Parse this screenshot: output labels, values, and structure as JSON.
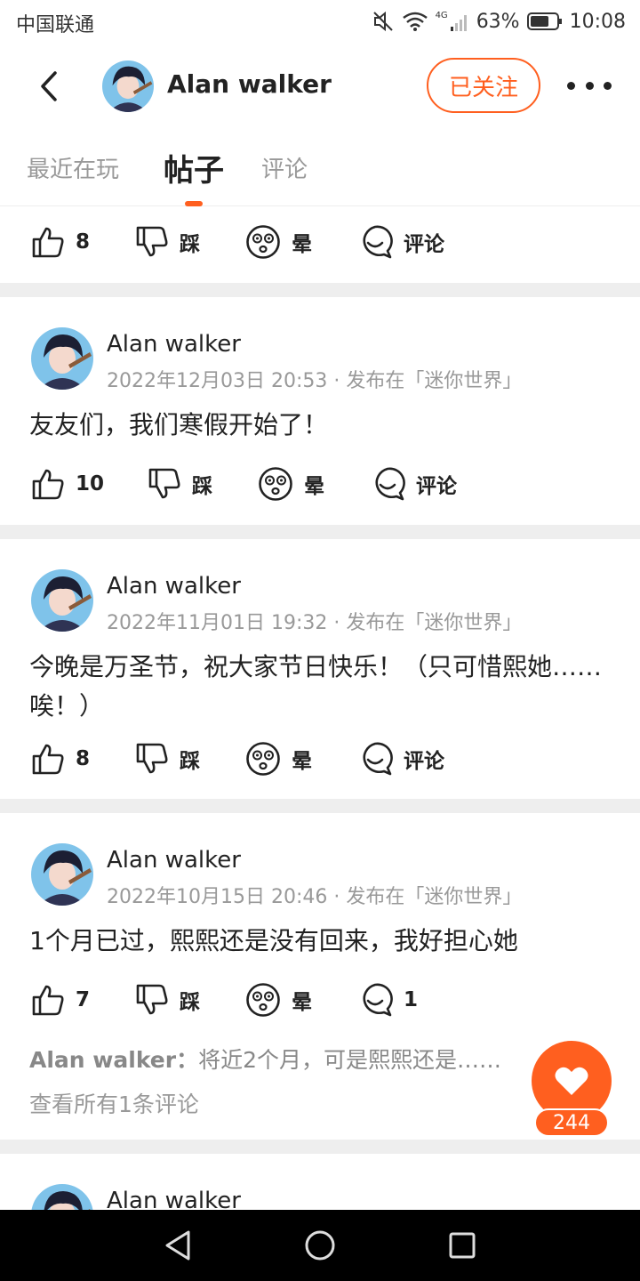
{
  "statusbar": {
    "carrier": "中国联通",
    "network": "4G",
    "battery": "63%",
    "time": "10:08",
    "icons": [
      "mute-icon",
      "wifi-icon",
      "signal-icon",
      "battery-icon"
    ]
  },
  "header": {
    "user_name": "Alan walker",
    "follow_label": "已关注",
    "icons": [
      "back-icon",
      "more-icon"
    ]
  },
  "tabs": [
    {
      "label": "最近在玩",
      "active": false
    },
    {
      "label": "帖子",
      "active": true
    },
    {
      "label": "评论",
      "active": false
    }
  ],
  "actions": {
    "dislike_label": "踩",
    "dizzy_label": "晕",
    "comment_label": "评论"
  },
  "top_partial_post": {
    "likes": "8"
  },
  "posts": [
    {
      "author": "Alan walker",
      "date": "2022年12月03日 20:53",
      "published_in": "发布在「迷你世界」",
      "content": "友友们，我们寒假开始了！",
      "likes": "10",
      "comment_text": "评论"
    },
    {
      "author": "Alan walker",
      "date": "2022年11月01日 19:32",
      "published_in": "发布在「迷你世界」",
      "content": "今晚是万圣节，祝大家节日快乐！（只可惜熙她……唉！）",
      "likes": "8",
      "comment_text": "评论"
    },
    {
      "author": "Alan walker",
      "date": "2022年10月15日 20:46",
      "published_in": "发布在「迷你世界」",
      "content": "1个月已过，熙熙还是没有回来，我好担心她",
      "likes": "7",
      "comment_text": "1",
      "comment_preview_author": "Alan walker：",
      "comment_preview_text": "将近2个月，可是熙熙还是……",
      "view_all": "查看所有1条评论"
    },
    {
      "author": "Alan walker"
    }
  ],
  "like_fab": {
    "count": "244"
  },
  "colors": {
    "accent": "#ff5f1f",
    "divider": "#eeeeee",
    "meta": "#999999"
  }
}
